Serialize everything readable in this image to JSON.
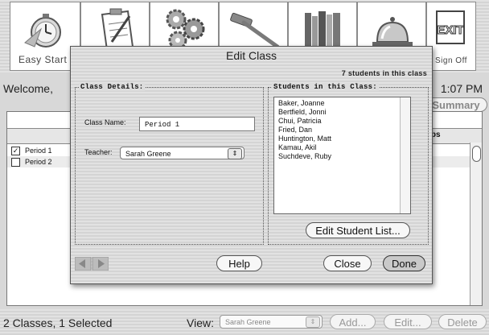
{
  "toolbar": {
    "items": [
      {
        "label": "Easy Start",
        "icon": "stopwatch-icon"
      },
      {
        "label": "",
        "icon": "clipboard-icon"
      },
      {
        "label": "",
        "icon": "gears-icon"
      },
      {
        "label": "",
        "icon": "hammer-icon"
      },
      {
        "label": "",
        "icon": "books-icon"
      },
      {
        "label": "",
        "icon": "service-bell-icon"
      },
      {
        "label": "Sign Off",
        "icon": "exit-sign-icon",
        "sign_text": "EXIT"
      }
    ]
  },
  "main": {
    "welcome": "Welcome,",
    "time": "1:07 PM",
    "summary_button": "Summary",
    "groups_column": "Groups",
    "rows": [
      {
        "name": "Period 1",
        "checked": true,
        "check_mark": "✓"
      },
      {
        "name": "Period 2",
        "checked": false,
        "check_mark": ""
      }
    ]
  },
  "status": {
    "text": "2 Classes, 1 Selected",
    "view_label": "View:",
    "view_value": "Sarah Greene",
    "add_button": "Add...",
    "edit_button": "Edit...",
    "delete_button": "Delete"
  },
  "dialog": {
    "title": "Edit Class",
    "count": "7 students in this class",
    "class_details_title": "Class Details:",
    "class_name_label": "Class Name:",
    "class_name_value": "Period 1",
    "teacher_label": "Teacher:",
    "teacher_value": "Sarah Greene",
    "students_title": "Students in this Class:",
    "students": [
      "Baker, Joanne",
      "Bertfield, Jonni",
      "Chui, Patricia",
      "Fried, Dan",
      "Huntington, Matt",
      "Kamau, Akil",
      "Suchdeve, Ruby"
    ],
    "edit_student_list_button": "Edit Student List...",
    "help_button": "Help",
    "close_button": "Close",
    "done_button": "Done"
  },
  "colors": {
    "background": "#d8d8d8",
    "panel": "#ffffff",
    "done_button": "#c9c9c9"
  }
}
